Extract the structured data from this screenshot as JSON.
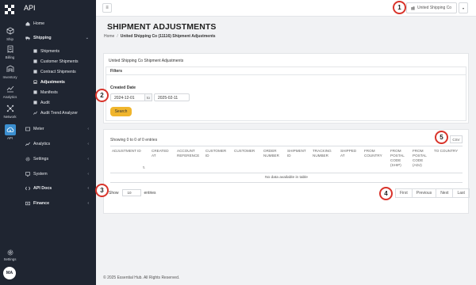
{
  "rail": {
    "items": [
      {
        "label": "Ship",
        "icon": "cube-icon"
      },
      {
        "label": "Billing",
        "icon": "receipt-icon"
      },
      {
        "label": "Inventory",
        "icon": "warehouse-icon"
      },
      {
        "label": "Analytics",
        "icon": "chart-icon"
      },
      {
        "label": "Network",
        "icon": "network-icon"
      },
      {
        "label": "API",
        "icon": "cloud-gear-icon"
      }
    ],
    "settings_label": "Settings",
    "avatar": "MA"
  },
  "sidebar": {
    "title": "API",
    "items": [
      {
        "label": "Home",
        "icon": "home-icon",
        "chevron": ""
      },
      {
        "label": "Shipping",
        "icon": "truck-icon",
        "chevron": "⌄"
      },
      {
        "label": "Meter",
        "icon": "meter-icon",
        "chevron": "‹"
      },
      {
        "label": "Analytics",
        "icon": "analytics-icon",
        "chevron": "‹"
      },
      {
        "label": "Settings",
        "icon": "settings-icon",
        "chevron": "‹"
      },
      {
        "label": "System",
        "icon": "system-icon",
        "chevron": "‹"
      },
      {
        "label": "API Docs",
        "icon": "docs-icon",
        "chevron": "‹"
      },
      {
        "label": "Finance",
        "icon": "finance-icon",
        "chevron": "‹"
      }
    ],
    "shipping_sub": [
      {
        "label": "Shipments"
      },
      {
        "label": "Customer Shipments"
      },
      {
        "label": "Contract Shipments"
      },
      {
        "label": "Adjustments"
      },
      {
        "label": "Manifests"
      },
      {
        "label": "Audit"
      },
      {
        "label": "Audit Trend Analyzer"
      }
    ]
  },
  "topbar": {
    "menu_glyph": "≡",
    "org_label": "United Shipping Co",
    "dropdown_glyph": "▾"
  },
  "page": {
    "title": "SHIPMENT ADJUSTMENTS",
    "breadcrumb_home": "Home",
    "breadcrumb_sep": "/",
    "breadcrumb_current": "United Shipping Co (11116) Shipment Adjustments"
  },
  "filters_card": {
    "heading": "United Shipping Co Shipment Adjustments",
    "filters_title": "Filters",
    "created_date_label": "Created Date",
    "date_from": "2024-12-01",
    "to_label": "to",
    "date_to": "2025-02-11",
    "search_label": "Search"
  },
  "results": {
    "showing": "Showing 0 to 0 of 0 entries",
    "csv_label": "CSV",
    "columns": [
      "ADJUSTMENT ID",
      "CREATED AT",
      "ACCOUNT REFERENCE",
      "CUSTOMER ID",
      "CUSTOMER",
      "ORDER NUMBER",
      "SHIPMENT ID",
      "TRACKING NUMBER",
      "SHIPPED AT",
      "FROM COUNTRY",
      "FROM POSTAL CODE (SHIP)",
      "FROM POSTAL CODE (ADJ)",
      "TO COUNTRY"
    ],
    "sort_glyph": "⇅",
    "empty_text": "No data available in table",
    "show_label": "Show",
    "page_size": "10",
    "entries_label": "entries",
    "pager": [
      "First",
      "Previous",
      "Next",
      "Last"
    ]
  },
  "footer": "© 2025 Essential Hub. All Rights Reserved.",
  "callouts": [
    "1",
    "2",
    "3",
    "4",
    "5"
  ],
  "colors": {
    "dark": "#1f2531",
    "accent": "#f0b52c",
    "callout_border": "#d9342b",
    "active_rail": "#3b8fd0"
  }
}
